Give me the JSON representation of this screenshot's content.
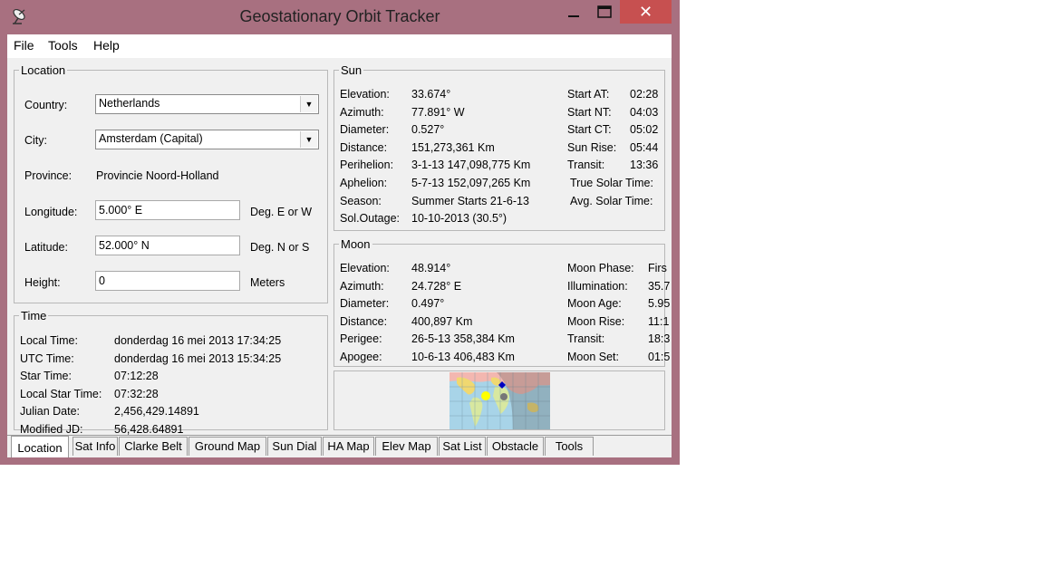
{
  "window": {
    "title": "Geostationary Orbit Tracker",
    "close_glyph": "✕"
  },
  "menu": {
    "items": [
      {
        "label": "File"
      },
      {
        "label": "Tools"
      },
      {
        "label": "Help"
      }
    ]
  },
  "location": {
    "legend": "Location",
    "country_label": "Country:",
    "country_value": "Netherlands",
    "city_label": "City:",
    "city_value": "Amsterdam (Capital)",
    "province_label": "Province:",
    "province_value": "Provincie Noord-Holland",
    "longitude_label": "Longitude:",
    "longitude_value": "5.000° E",
    "longitude_unit": "Deg. E or W",
    "latitude_label": "Latitude:",
    "latitude_value": "52.000° N",
    "latitude_unit": "Deg. N or S",
    "height_label": "Height:",
    "height_value": "0",
    "height_unit": "Meters"
  },
  "time": {
    "legend": "Time",
    "rows": [
      {
        "label": "Local Time:",
        "value": "donderdag 16 mei 2013  17:34:25"
      },
      {
        "label": "UTC Time:",
        "value": "donderdag 16 mei 2013  15:34:25"
      },
      {
        "label": "Star Time:",
        "value": "07:12:28"
      },
      {
        "label": "Local Star Time:",
        "value": "07:32:28"
      },
      {
        "label": "Julian Date:",
        "value": "2,456,429.14891"
      },
      {
        "label": "Modified JD:",
        "value": "56,428.64891"
      }
    ]
  },
  "sun": {
    "legend": "Sun",
    "rows": [
      {
        "label": "Elevation:",
        "value": "33.674°"
      },
      {
        "label": "Azimuth:",
        "value": "77.891° W"
      },
      {
        "label": "Diameter:",
        "value": "0.527°"
      },
      {
        "label": "Distance:",
        "value": "151,273,361 Km"
      },
      {
        "label": "Perihelion:",
        "value": "3-1-13 147,098,775 Km"
      },
      {
        "label": "Aphelion:",
        "value": "5-7-13 152,097,265 Km"
      },
      {
        "label": "Season:",
        "value": "Summer Starts 21-6-13"
      },
      {
        "label": "Sol.Outage:",
        "value": "10-10-2013 (30.5°)"
      }
    ],
    "right_rows": [
      {
        "label": "Start AT:",
        "value": "02:28"
      },
      {
        "label": "Start NT:",
        "value": "04:03"
      },
      {
        "label": "Start CT:",
        "value": "05:02"
      },
      {
        "label": "Sun Rise:",
        "value": "05:44"
      },
      {
        "label": "Transit:",
        "value": "13:36"
      },
      {
        "label": "True Solar Time:",
        "value": ""
      },
      {
        "label": "Avg. Solar Time:",
        "value": ""
      }
    ]
  },
  "moon": {
    "legend": "Moon",
    "rows": [
      {
        "label": "Elevation:",
        "value": "48.914°"
      },
      {
        "label": "Azimuth:",
        "value": "24.728° E"
      },
      {
        "label": "Diameter:",
        "value": "0.497°"
      },
      {
        "label": "Distance:",
        "value": "400,897 Km"
      },
      {
        "label": "Perigee:",
        "value": "26-5-13 358,384 Km"
      },
      {
        "label": "Apogee:",
        "value": "10-6-13 406,483 Km"
      }
    ],
    "right_rows": [
      {
        "label": "Moon Phase:",
        "value": "Firs"
      },
      {
        "label": "Illumination:",
        "value": "35.7"
      },
      {
        "label": "Moon Age:",
        "value": "5.95"
      },
      {
        "label": "Moon Rise:",
        "value": "11:1"
      },
      {
        "label": "Transit:",
        "value": "18:3"
      },
      {
        "label": "Moon Set:",
        "value": "01:5"
      }
    ]
  },
  "tabs": [
    {
      "label": "Location",
      "active": true
    },
    {
      "label": "Sat Info"
    },
    {
      "label": "Clarke Belt"
    },
    {
      "label": "Ground Map"
    },
    {
      "label": "Sun Dial"
    },
    {
      "label": "HA Map"
    },
    {
      "label": "Elev Map"
    },
    {
      "label": "Sat List"
    },
    {
      "label": "Obstacle"
    },
    {
      "label": "Tools"
    }
  ],
  "colors": {
    "title_bar": "#a87080",
    "close_button": "#c75050",
    "panel": "#f0f0f0"
  }
}
